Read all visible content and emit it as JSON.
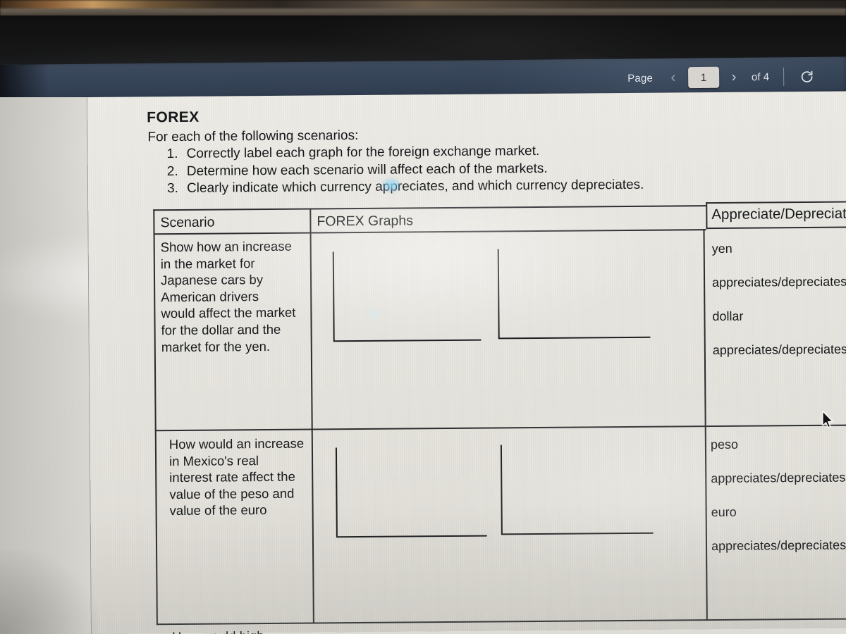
{
  "viewer": {
    "pager": {
      "page_label": "Page",
      "prev_icon": "chevron-left-icon",
      "next_icon": "chevron-right-icon",
      "current_page": "1",
      "of_total": "of 4",
      "refresh_icon": "refresh-icon"
    }
  },
  "document": {
    "title": "FOREX",
    "intro": "For each of the following scenarios:",
    "instructions": [
      {
        "num": "1.",
        "text": "Correctly label each graph for the foreign exchange market."
      },
      {
        "num": "2.",
        "text": "Determine how each scenario will affect each of the markets."
      },
      {
        "num": "3.",
        "text": "Clearly indicate which currency appreciates, and which currency depreciates."
      }
    ],
    "table": {
      "headers": {
        "scenario": "Scenario",
        "graphs": "FOREX Graphs",
        "appreciate_depreciate": "Appreciate/Depreciate"
      },
      "rows": [
        {
          "scenario": "Show how an increase\nin the market for\nJapanese cars by\nAmerican drivers\nwould affect the market\nfor the dollar and the\nmarket for the yen.",
          "graphs": [
            "blank-axes-left",
            "blank-axes-right"
          ],
          "appreciate_depreciate": [
            "yen",
            "appreciates/depreciates",
            "dollar",
            "appreciates/depreciates"
          ]
        },
        {
          "scenario": "How would an increase\nin Mexico's real\ninterest rate affect the\nvalue of the peso and\nvalue of the euro",
          "graphs": [
            "blank-axes-left",
            "blank-axes-right"
          ],
          "appreciate_depreciate": [
            "peso",
            "appreciates/depreciates",
            "euro",
            "appreciates/depreciates"
          ]
        },
        {
          "scenario": "How would high",
          "graphs": [],
          "appreciate_depreciate": []
        }
      ]
    }
  },
  "colors": {
    "toolbar_bg": "#38465a",
    "page_bg": "#e9e7e1",
    "ink": "#17191b",
    "pagebox_bg": "#d7d4cf"
  }
}
